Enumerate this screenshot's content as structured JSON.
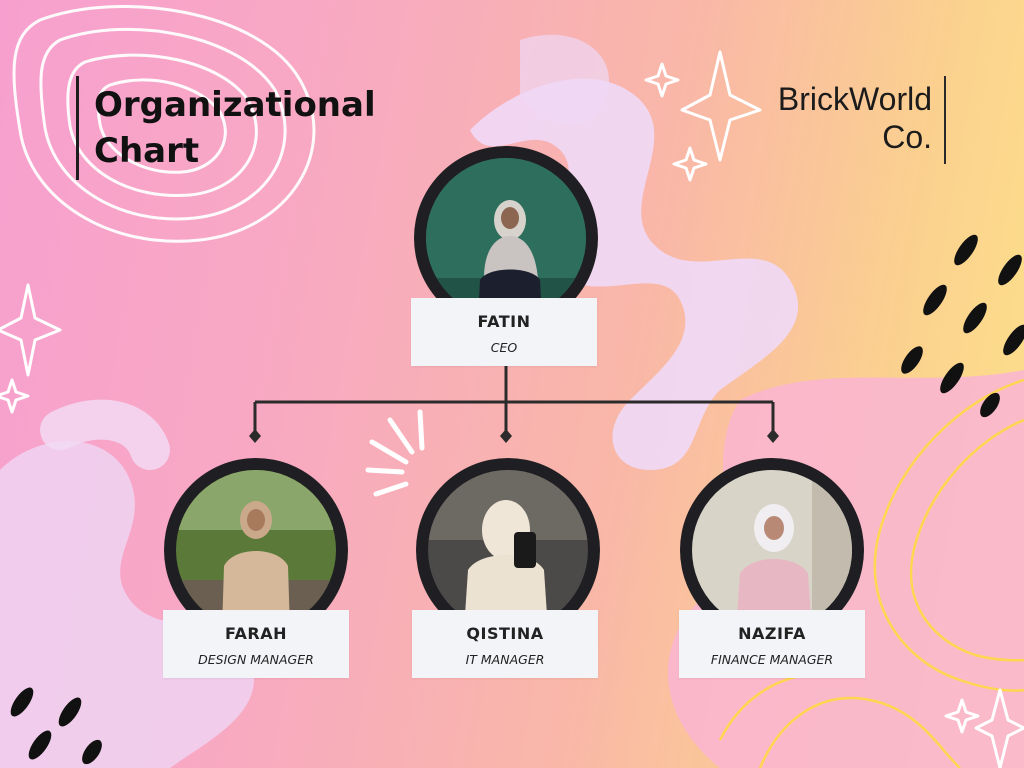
{
  "header": {
    "title": "Organizational Chart",
    "brand": "BrickWorld Co."
  },
  "org": {
    "root": {
      "name": "FATIN",
      "role": "CEO"
    },
    "children": [
      {
        "name": "FARAH",
        "role": "DESIGN MANAGER"
      },
      {
        "name": "QISTINA",
        "role": "IT MANAGER"
      },
      {
        "name": "NAZIFA",
        "role": "FINANCE MANAGER"
      }
    ]
  },
  "colors": {
    "connector": "#2b2b2b",
    "photo_ring": "#1f1f23",
    "label_bg": "#f3f4f8"
  }
}
